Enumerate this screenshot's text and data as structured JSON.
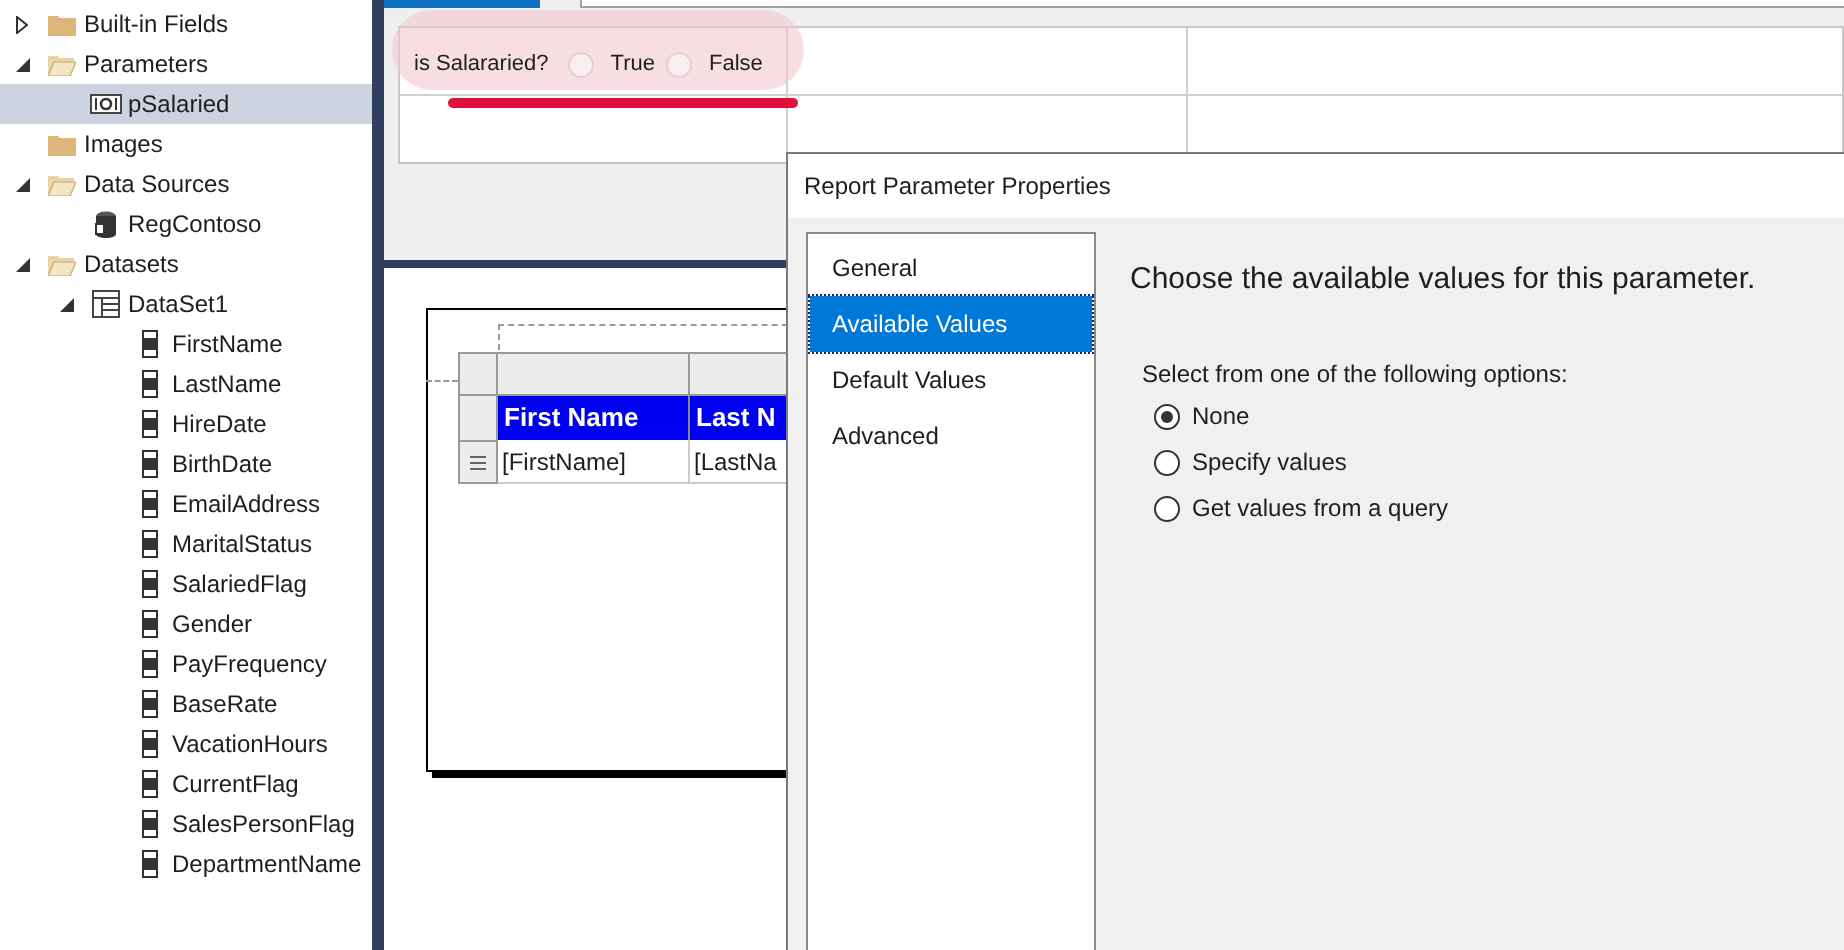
{
  "report_data_tree": [
    {
      "label": "Built-in Fields",
      "kind": "folder",
      "expanded": false,
      "selected": false
    },
    {
      "label": "Parameters",
      "kind": "folder",
      "expanded": true,
      "selected": false,
      "children": [
        {
          "label": "pSalaried",
          "kind": "parameter",
          "selected": true
        }
      ]
    },
    {
      "label": "Images",
      "kind": "folder",
      "selected": false
    },
    {
      "label": "Data Sources",
      "kind": "folder",
      "expanded": true,
      "selected": false,
      "children": [
        {
          "label": "RegContoso",
          "kind": "datasource",
          "selected": false
        }
      ]
    },
    {
      "label": "Datasets",
      "kind": "folder",
      "expanded": true,
      "selected": false,
      "children": [
        {
          "label": "DataSet1",
          "kind": "dataset",
          "expanded": true,
          "selected": false,
          "children": [
            {
              "label": "FirstName",
              "kind": "field",
              "selected": false
            },
            {
              "label": "LastName",
              "kind": "field",
              "selected": false
            },
            {
              "label": "HireDate",
              "kind": "field",
              "selected": false
            },
            {
              "label": "BirthDate",
              "kind": "field",
              "selected": false
            },
            {
              "label": "EmailAddress",
              "kind": "field",
              "selected": false
            },
            {
              "label": "MaritalStatus",
              "kind": "field",
              "selected": false
            },
            {
              "label": "SalariedFlag",
              "kind": "field",
              "selected": false
            },
            {
              "label": "Gender",
              "kind": "field",
              "selected": false
            },
            {
              "label": "PayFrequency",
              "kind": "field",
              "selected": false
            },
            {
              "label": "BaseRate",
              "kind": "field",
              "selected": false
            },
            {
              "label": "VacationHours",
              "kind": "field",
              "selected": false
            },
            {
              "label": "CurrentFlag",
              "kind": "field",
              "selected": false
            },
            {
              "label": "SalesPersonFlag",
              "kind": "field",
              "selected": false
            },
            {
              "label": "DepartmentName",
              "kind": "field",
              "selected": false
            }
          ]
        }
      ]
    }
  ],
  "parameter_pane": {
    "label": "is Salararied?",
    "options": [
      {
        "label": "True",
        "selected": false
      },
      {
        "label": "False",
        "selected": false
      }
    ]
  },
  "report_table": {
    "columns": [
      "First Name",
      "Last N"
    ],
    "rows": [
      [
        "[FirstName]",
        "[LastNa"
      ]
    ]
  },
  "dialog": {
    "title": "Report Parameter Properties",
    "nav": [
      {
        "label": "General",
        "selected": false
      },
      {
        "label": "Available Values",
        "selected": true
      },
      {
        "label": "Default Values",
        "selected": false
      },
      {
        "label": "Advanced",
        "selected": false
      }
    ],
    "heading": "Choose the available values for this parameter.",
    "prompt": "Select from one of the following options:",
    "options": [
      {
        "label": "None",
        "selected": true
      },
      {
        "label": "Specify values",
        "selected": false
      },
      {
        "label": "Get values from a query",
        "selected": false
      }
    ]
  }
}
